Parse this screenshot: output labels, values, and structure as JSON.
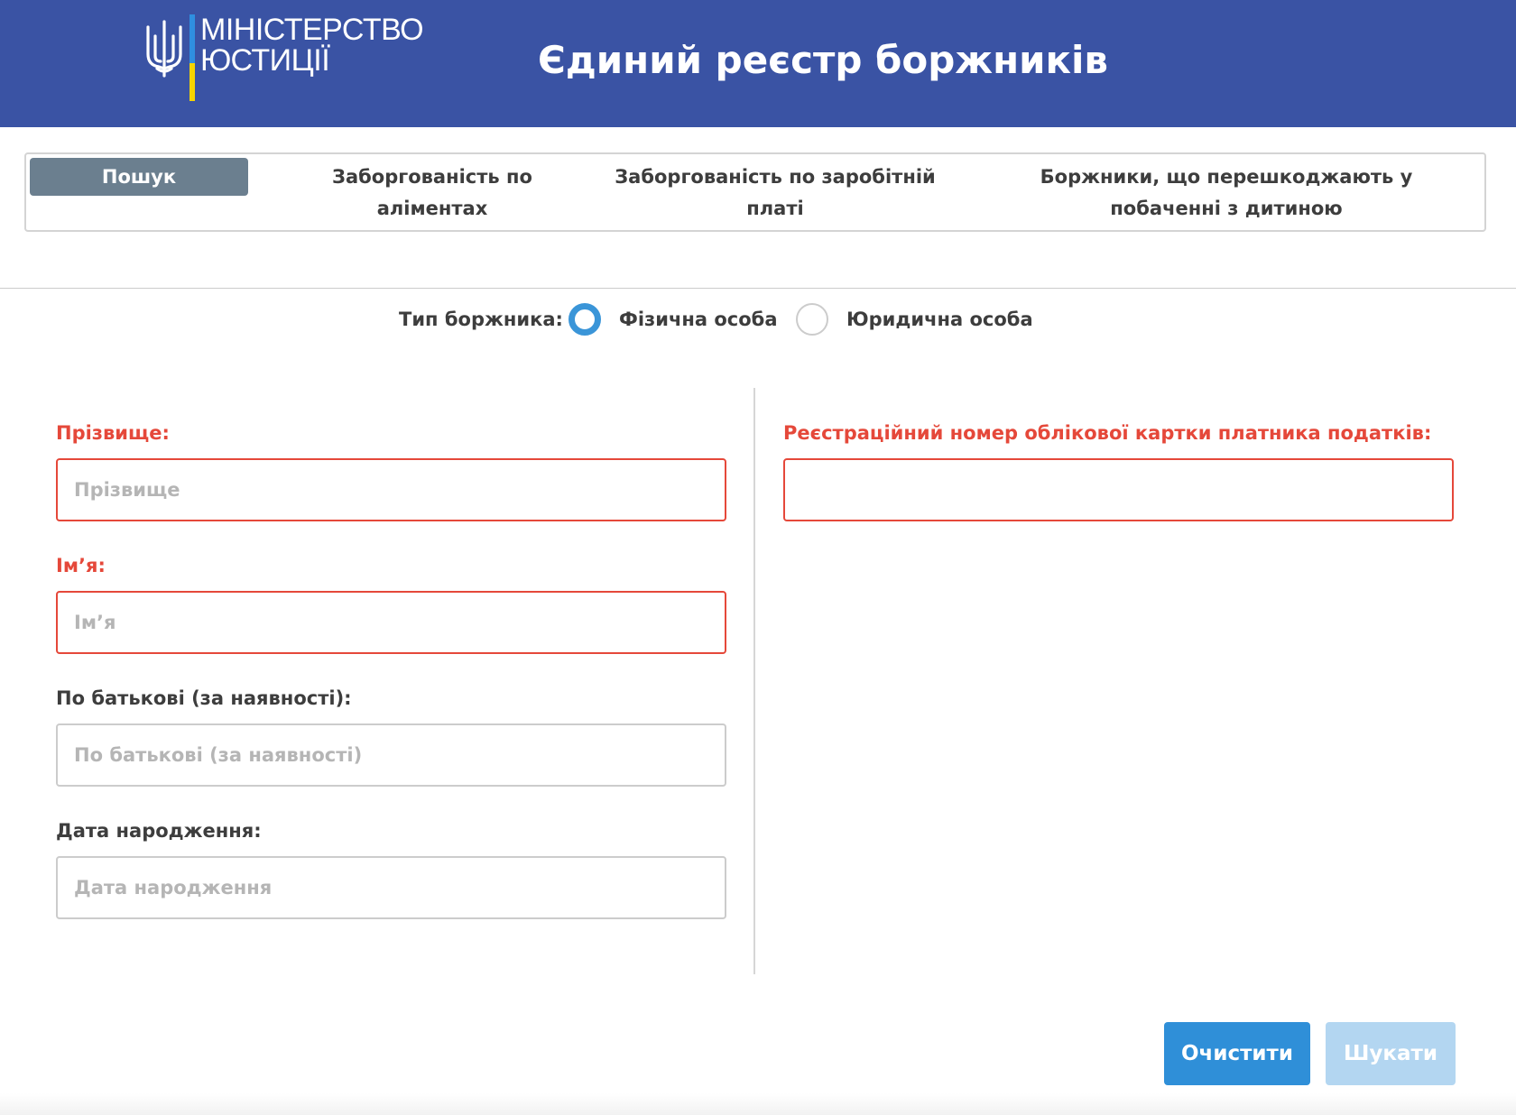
{
  "header": {
    "logo_line1": "МІНІСТЕРСТВО",
    "logo_line2": "ЮСТИЦІЇ",
    "title": "Єдиний реєстр боржників",
    "background_color": "#3a53a4",
    "logo_icon": "trident-icon"
  },
  "tabs": [
    {
      "label": "Пошук",
      "active": true
    },
    {
      "label": "Заборгованість по аліментах",
      "active": false
    },
    {
      "label": "Заборгованість по заробітній платі",
      "active": false
    },
    {
      "label": "Боржники, що перешкоджають у побаченні з дитиною",
      "active": false
    }
  ],
  "debtor_type": {
    "label": "Тип боржника:",
    "options": [
      {
        "label": "Фізична особа",
        "selected": true
      },
      {
        "label": "Юридична особа",
        "selected": false
      }
    ]
  },
  "form": {
    "surname": {
      "label": "Прізвище:",
      "placeholder": "Прізвище",
      "value": "",
      "required": true
    },
    "name": {
      "label": "Ім’я:",
      "placeholder": "Ім’я",
      "value": "",
      "required": true
    },
    "patronymic": {
      "label": "По батькові (за наявності):",
      "placeholder": "По батькові (за наявності)",
      "value": "",
      "required": false
    },
    "birth_date": {
      "label": "Дата народження:",
      "placeholder": "Дата народження",
      "value": "",
      "required": false
    },
    "tax_id": {
      "label": "Реєстраційний номер облікової картки платника податків:",
      "placeholder": "",
      "value": "",
      "required": true
    }
  },
  "buttons": {
    "clear_label": "Очистити",
    "search_label": "Шукати"
  },
  "colors": {
    "accent": "#2f8fd8",
    "required": "#e5483a",
    "active_tab": "#6b7f8f",
    "search_disabled": "#b3d6f1"
  }
}
